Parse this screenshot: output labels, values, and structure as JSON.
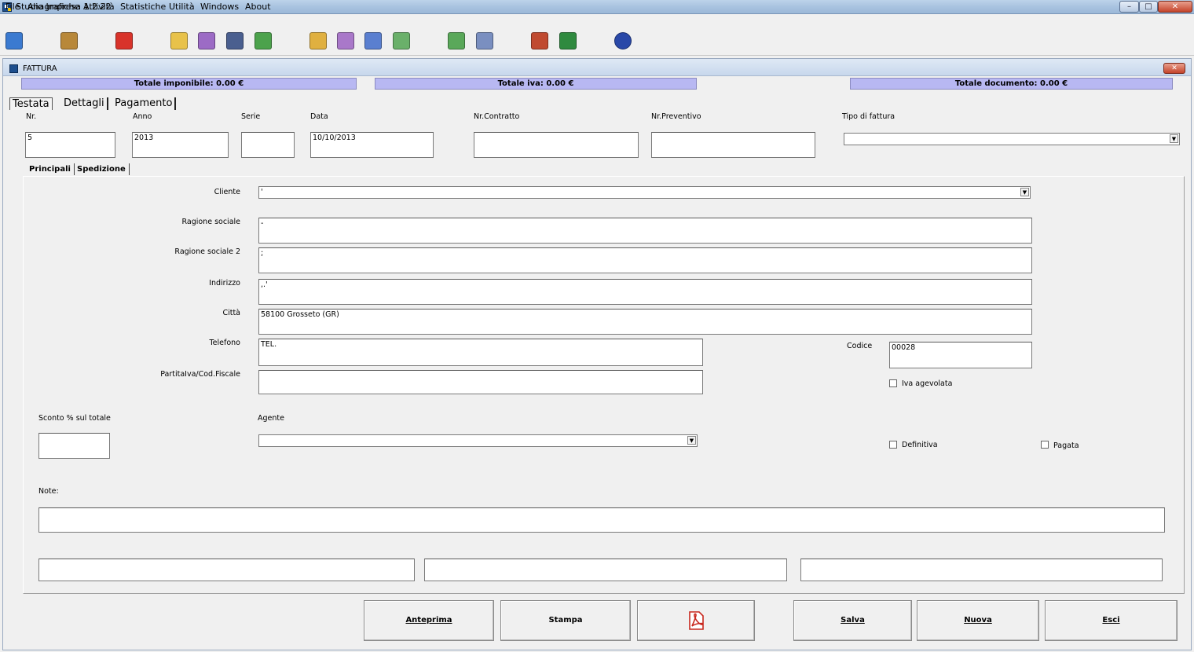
{
  "window": {
    "title": "Studio Impresa 1.2.22"
  },
  "menu": [
    "File",
    "Anagrafiche",
    "Attività",
    "Statistiche",
    "Utilità",
    "Windows",
    "About"
  ],
  "toolbar": [
    {
      "name": "anagrafiche-icon",
      "color": "#3b7ad0"
    },
    {
      "name": "articoli-icon",
      "color": "#b8883a"
    },
    {
      "name": "calculator-icon",
      "color": "#d8332a"
    },
    {
      "name": "notepad-icon",
      "color": "#e8c24a"
    },
    {
      "name": "document-purple-icon",
      "color": "#9c6bc5"
    },
    {
      "name": "print-icon",
      "color": "#4a5f8f"
    },
    {
      "name": "document-green-icon",
      "color": "#4ca24c"
    },
    {
      "name": "folder-yellow-icon",
      "color": "#e0b040"
    },
    {
      "name": "folder-purple-icon",
      "color": "#a978c9"
    },
    {
      "name": "folder-blue-icon",
      "color": "#5a7fd0"
    },
    {
      "name": "folder-green-icon",
      "color": "#6ab06a"
    },
    {
      "name": "calendar-clock-green-icon",
      "color": "#5aa85a"
    },
    {
      "name": "calendar-clock-blue-icon",
      "color": "#7a8fc0"
    },
    {
      "name": "window-export-icon",
      "color": "#c04a30"
    },
    {
      "name": "excel-icon",
      "color": "#2f8a3f"
    },
    {
      "name": "power-icon",
      "color": "#2948a8"
    }
  ],
  "child": {
    "title": "FATTURA",
    "totals": {
      "imponibile": "Totale imponibile:  0.00 €",
      "iva": "Totale iva:  0.00 €",
      "documento": "Totale documento:  0.00 €"
    },
    "tabs": [
      "Testata",
      "Dettagli",
      "Pagamento"
    ],
    "header_fields": {
      "nr_label": "Nr.",
      "nr_value": "5",
      "anno_label": "Anno",
      "anno_value": "2013",
      "serie_label": "Serie",
      "serie_value": "",
      "data_label": "Data",
      "data_value": "10/10/2013",
      "contratto_label": "Nr.Contratto",
      "contratto_value": "",
      "preventivo_label": "Nr.Preventivo",
      "preventivo_value": "",
      "tipo_label": "Tipo di fattura",
      "tipo_value": ""
    },
    "subtabs": [
      "Principali",
      "Spedizione"
    ],
    "principali": {
      "cliente_label": "Cliente",
      "cliente_value": "'",
      "ragione_label": "Ragione sociale",
      "ragione_value": "-",
      "ragione2_label": "Ragione sociale 2",
      "ragione2_value": ";",
      "indirizzo_label": "Indirizzo",
      "indirizzo_value": ",.'",
      "citta_label": "Città",
      "citta_value": "58100 Grosseto  (GR)",
      "telefono_label": "Telefono",
      "telefono_value": "TEL.",
      "piva_label": "PartitaIva/Cod.Fiscale",
      "piva_value": "",
      "codice_label": "Codice",
      "codice_value": "00028",
      "iva_agevolata_label": "Iva agevolata",
      "sconto_label": "Sconto % sul totale",
      "sconto_value": "",
      "agente_label": "Agente",
      "agente_value": "",
      "definitiva_label": "Definitiva",
      "pagata_label": "Pagata",
      "note_label": "Note:",
      "note_value": ""
    },
    "buttons": {
      "anteprima": "Anteprima",
      "stampa": "Stampa",
      "pdf_icon": "pdf-icon",
      "salva": "Salva",
      "nuova": "Nuova",
      "esci": "Esci"
    }
  }
}
